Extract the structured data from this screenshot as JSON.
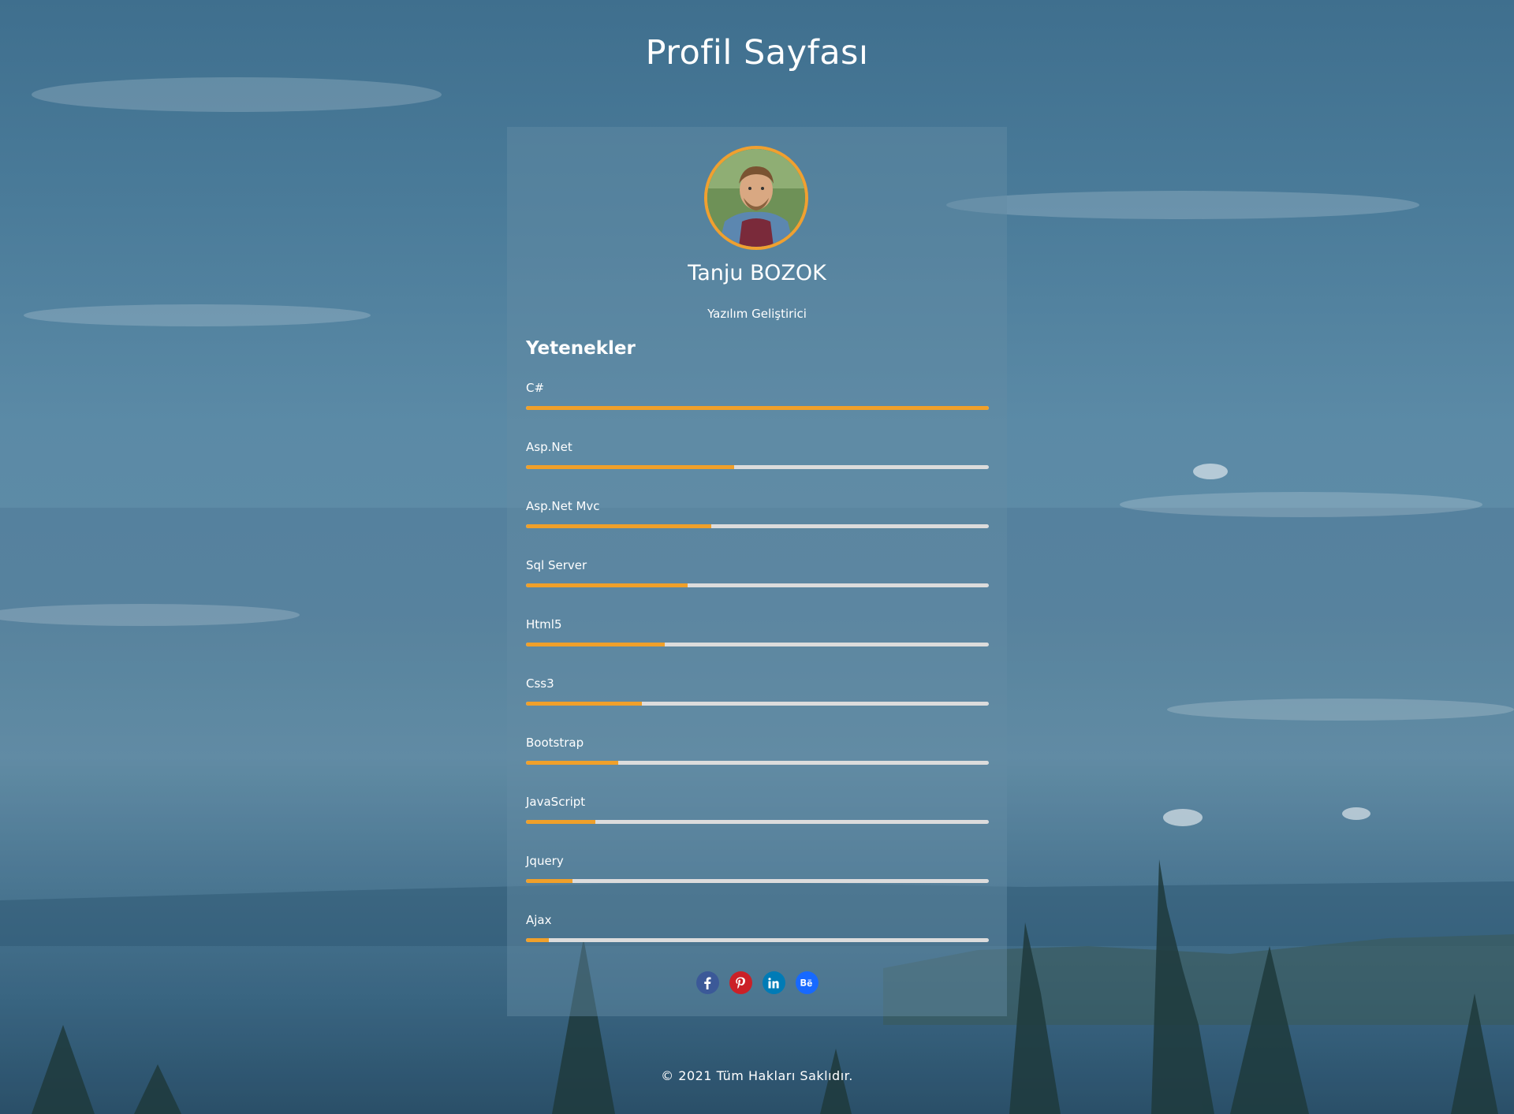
{
  "page": {
    "title": "Profil Sayfası"
  },
  "profile": {
    "name": "Tanju BOZOK",
    "role": "Yazılım Geliştirici",
    "avatar_icon": "profile-photo"
  },
  "skills": {
    "heading": "Yetenekler",
    "items": [
      {
        "label": "C#",
        "level": 1.0
      },
      {
        "label": "Asp.Net",
        "level": 0.45
      },
      {
        "label": "Asp.Net Mvc",
        "level": 0.4
      },
      {
        "label": "Sql Server",
        "level": 0.35
      },
      {
        "label": "Html5",
        "level": 0.3
      },
      {
        "label": "Css3",
        "level": 0.25
      },
      {
        "label": "Bootstrap",
        "level": 0.2
      },
      {
        "label": "JavaScript",
        "level": 0.15
      },
      {
        "label": "Jquery",
        "level": 0.1
      },
      {
        "label": "Ajax",
        "level": 0.05
      }
    ]
  },
  "social": [
    {
      "name": "facebook",
      "icon": "facebook-icon",
      "color": "#3b5998"
    },
    {
      "name": "pinterest",
      "icon": "pinterest-icon",
      "color": "#cb2027"
    },
    {
      "name": "linkedin",
      "icon": "linkedin-icon",
      "color": "#007bb6"
    },
    {
      "name": "behance",
      "icon": "behance-icon",
      "color": "#1769ff"
    }
  ],
  "colors": {
    "accent": "#f0a02a",
    "track": "#dcdcdc",
    "avatar_border": "#f0a030"
  },
  "footer": {
    "text": "© 2021 Tüm Hakları Saklıdır."
  }
}
